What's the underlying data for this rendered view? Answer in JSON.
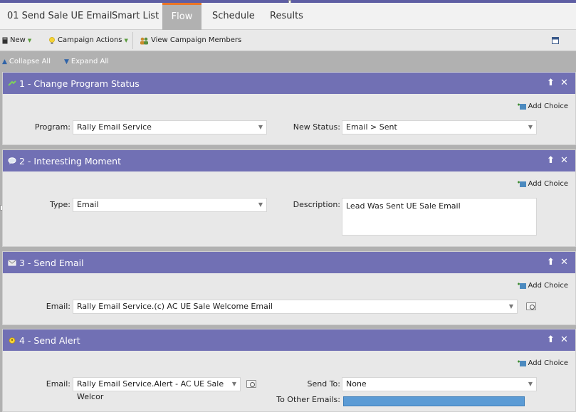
{
  "tabs": [
    {
      "label": "01 Send Sale UE Email"
    },
    {
      "label": "Smart List"
    },
    {
      "label": "Flow"
    },
    {
      "label": "Schedule"
    },
    {
      "label": "Results"
    }
  ],
  "active_tab": "Flow",
  "toolbar": {
    "new_label": "New",
    "campaign_actions_label": "Campaign Actions",
    "view_members_label": "View Campaign Members"
  },
  "subbar": {
    "collapse_label": "Collapse All",
    "expand_label": "Expand All"
  },
  "add_choice_label": "Add Choice",
  "steps": [
    {
      "title": "1 - Change Program Status",
      "program_label": "Program:",
      "program_value": "Rally Email Service",
      "status_label": "New Status:",
      "status_value": "Email > Sent"
    },
    {
      "title": "2 - Interesting Moment",
      "type_label": "Type:",
      "type_value": "Email",
      "description_label": "Description:",
      "description_value": "Lead Was Sent UE Sale Email"
    },
    {
      "title": "3 - Send Email",
      "email_label": "Email:",
      "email_value": "Rally Email Service.(c) AC UE Sale Welcome Email"
    },
    {
      "title": "4 - Send Alert",
      "email_label": "Email:",
      "email_value": "Rally Email Service.Alert - AC UE Sale Welcor",
      "send_to_label": "Send To:",
      "send_to_value": "None",
      "other_emails_label": "To Other Emails:",
      "other_emails_value": ""
    }
  ],
  "colors": {
    "step_header": "#7170b4",
    "active_tab_accent": "#ea7627",
    "other_emails_fill": "#5b9bd5"
  }
}
